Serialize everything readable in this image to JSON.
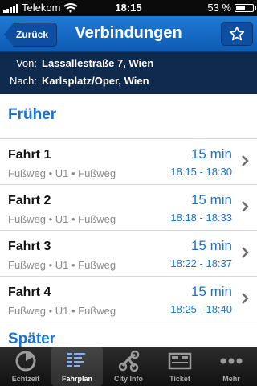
{
  "status": {
    "carrier": "Telekom",
    "time": "18:15",
    "battery": "53 %",
    "battery_level": 0.53
  },
  "nav": {
    "back_label": "Zurück",
    "title": "Verbindungen",
    "favorite_icon": "star-icon"
  },
  "route": {
    "from_label": "Von:",
    "from": "Lassallestraße 7, Wien",
    "to_label": "Nach:",
    "to": "Karlsplatz/Oper, Wien"
  },
  "sections": {
    "earlier": "Früher",
    "later": "Später"
  },
  "connections": [
    {
      "title": "Fahrt 1",
      "modes": "Fußweg • U1 • Fußweg",
      "duration": "15 min",
      "times": "18:15 - 18:30"
    },
    {
      "title": "Fahrt 2",
      "modes": "Fußweg • U1 • Fußweg",
      "duration": "15 min",
      "times": "18:18 - 18:33"
    },
    {
      "title": "Fahrt 3",
      "modes": "Fußweg • U1 • Fußweg",
      "duration": "15 min",
      "times": "18:22 - 18:37"
    },
    {
      "title": "Fahrt 4",
      "modes": "Fußweg • U1 • Fußweg",
      "duration": "15 min",
      "times": "18:25 - 18:40"
    }
  ],
  "tabs": [
    {
      "label": "Echtzeit",
      "icon": "clock-icon",
      "active": false
    },
    {
      "label": "Fahrplan",
      "icon": "timetable-icon",
      "active": true
    },
    {
      "label": "City Info",
      "icon": "network-icon",
      "active": false
    },
    {
      "label": "Ticket",
      "icon": "ticket-icon",
      "active": false
    },
    {
      "label": "Mehr",
      "icon": "more-dots-icon",
      "active": false
    }
  ],
  "colors": {
    "accent": "#1a73d2",
    "nav_bar": "#1565c0",
    "route_bg": "#0f2a4d"
  }
}
